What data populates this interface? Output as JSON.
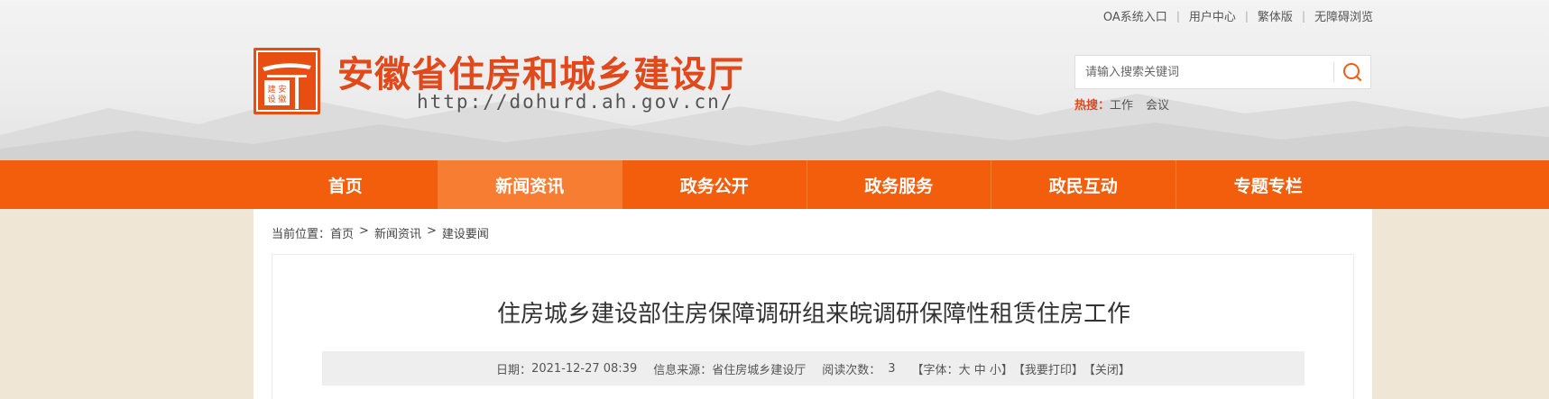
{
  "top_links": [
    "OA系统入口",
    "用户中心",
    "繁体版",
    "无障碍浏览"
  ],
  "site": {
    "title": "安徽省住房和城乡建设厅",
    "url": "http://dohurd.ah.gov.cn/",
    "logo_text": "安徽建设"
  },
  "search": {
    "placeholder": "请输入搜索关键词",
    "hot_label": "热搜：",
    "hot_keywords": [
      "工作",
      "会议"
    ]
  },
  "nav": [
    "首页",
    "新闻资讯",
    "政务公开",
    "政务服务",
    "政民互动",
    "专题专栏"
  ],
  "nav_active_index": 1,
  "breadcrumb": {
    "label": "当前位置：",
    "items": [
      "首页",
      "新闻资讯",
      "建设要闻"
    ],
    "separator": ">"
  },
  "article": {
    "title": "住房城乡建设部住房保障调研组来皖调研保障性租赁住房工作",
    "date_label": "日期：",
    "date": "2021-12-27 08:39",
    "source_label": "信息来源：",
    "source": "省住房城乡建设厅",
    "views_label": "阅读次数：",
    "views": "3",
    "font_label": "【字体：",
    "font_sizes": [
      "大",
      "中",
      "小"
    ],
    "font_close": "】",
    "print": "【我要打印】",
    "close": "【关闭】"
  },
  "colors": {
    "brand": "#f25e0c",
    "title_red": "#e2491a",
    "nav_active": "#f77d33"
  }
}
